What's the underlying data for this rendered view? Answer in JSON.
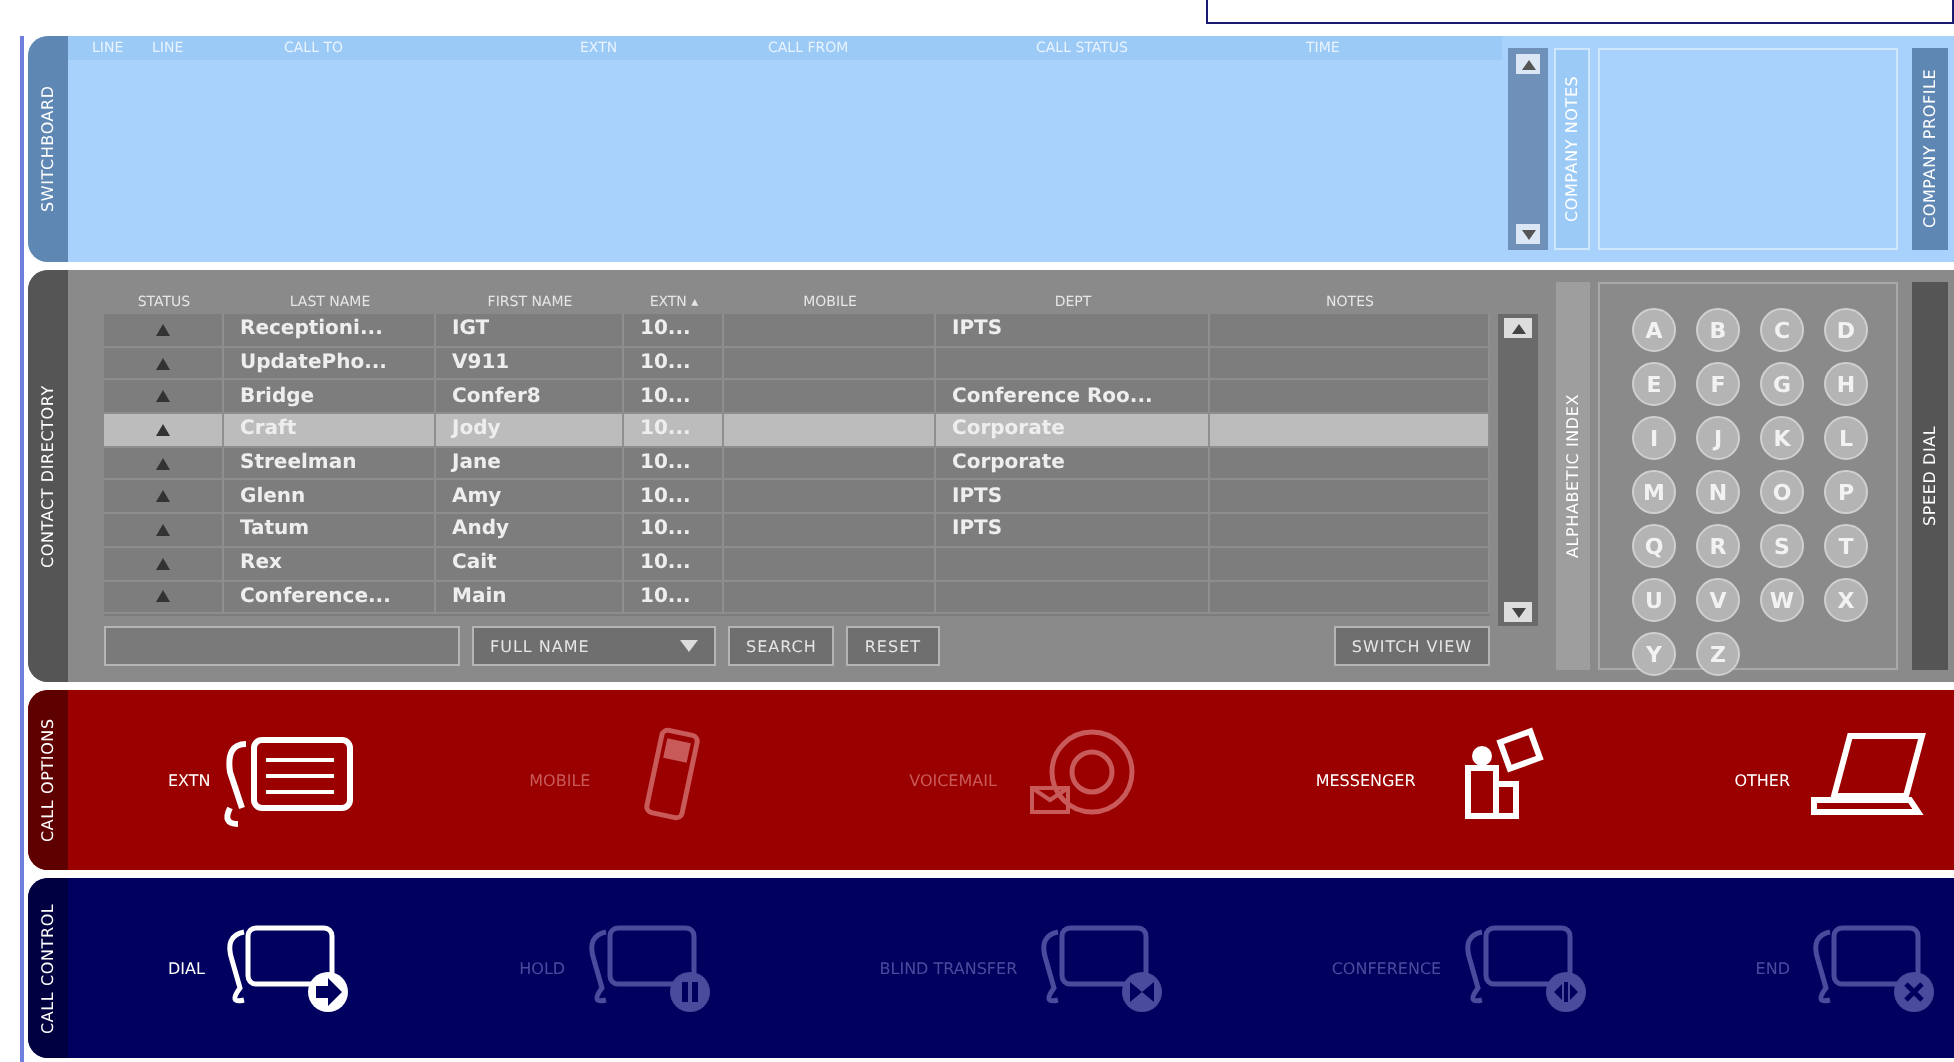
{
  "switchboard": {
    "tab": "SWITCHBOARD",
    "columns": [
      "LINE",
      "LINE",
      "CALL TO",
      "EXTN",
      "CALL FROM",
      "CALL STATUS",
      "TIME"
    ],
    "notes_tab": "COMPANY NOTES",
    "profile_tab": "COMPANY PROFILE"
  },
  "contact_directory": {
    "tab": "CONTACT DIRECTORY",
    "columns": [
      "STATUS",
      "LAST NAME",
      "FIRST NAME",
      "EXTN ▴",
      "MOBILE",
      "DEPT",
      "NOTES"
    ],
    "rows": [
      {
        "last_name": "Receptioni...",
        "first_name": "IGT",
        "extn": "10...",
        "mobile": "",
        "dept": "IPTS",
        "notes": "",
        "selected": false
      },
      {
        "last_name": "UpdatePho...",
        "first_name": "V911",
        "extn": "10...",
        "mobile": "",
        "dept": "",
        "notes": "",
        "selected": false
      },
      {
        "last_name": "Bridge",
        "first_name": "Confer8",
        "extn": "10...",
        "mobile": "",
        "dept": "Conference Roo...",
        "notes": "",
        "selected": false
      },
      {
        "last_name": "Craft",
        "first_name": "Jody",
        "extn": "10...",
        "mobile": "",
        "dept": "Corporate",
        "notes": "",
        "selected": true
      },
      {
        "last_name": "Streelman",
        "first_name": "Jane",
        "extn": "10...",
        "mobile": "",
        "dept": "Corporate",
        "notes": "",
        "selected": false
      },
      {
        "last_name": "Glenn",
        "first_name": "Amy",
        "extn": "10...",
        "mobile": "",
        "dept": "IPTS",
        "notes": "",
        "selected": false
      },
      {
        "last_name": "Tatum",
        "first_name": "Andy",
        "extn": "10...",
        "mobile": "",
        "dept": "IPTS",
        "notes": "",
        "selected": false
      },
      {
        "last_name": "Rex",
        "first_name": "Cait",
        "extn": "10...",
        "mobile": "",
        "dept": "",
        "notes": "",
        "selected": false
      },
      {
        "last_name": "Conference...",
        "first_name": "Main",
        "extn": "10...",
        "mobile": "",
        "dept": "",
        "notes": "",
        "selected": false
      }
    ],
    "search_by": "FULL NAME",
    "buttons": [
      "SEARCH",
      "RESET"
    ],
    "switch_view": "SWITCH VIEW",
    "index_tab": "ALPHABETIC INDEX",
    "letters": [
      "A",
      "B",
      "C",
      "D",
      "E",
      "F",
      "G",
      "H",
      "I",
      "J",
      "K",
      "L",
      "M",
      "N",
      "O",
      "P",
      "Q",
      "R",
      "S",
      "T",
      "U",
      "V",
      "W",
      "X",
      "Y",
      "Z"
    ],
    "speed_dial_tab": "SPEED DIAL"
  },
  "call_options": {
    "tab": "CALL OPTIONS",
    "items": [
      {
        "label": "EXTN",
        "kind": "deskphone",
        "disabled": false
      },
      {
        "label": "MOBILE",
        "kind": "mobile",
        "disabled": true
      },
      {
        "label": "VOICEMAIL",
        "kind": "voicemail",
        "disabled": true
      },
      {
        "label": "MESSENGER",
        "kind": "messenger",
        "disabled": false
      },
      {
        "label": "OTHER",
        "kind": "laptop",
        "disabled": false
      }
    ]
  },
  "call_control": {
    "tab": "CALL CONTROL",
    "items": [
      {
        "label": "DIAL",
        "kind": "dial",
        "disabled": false
      },
      {
        "label": "HOLD",
        "kind": "hold",
        "disabled": true
      },
      {
        "label": "BLIND TRANSFER",
        "kind": "transfer",
        "disabled": true
      },
      {
        "label": "CONFERENCE",
        "kind": "conference",
        "disabled": true
      },
      {
        "label": "END",
        "kind": "end",
        "disabled": true
      }
    ]
  }
}
